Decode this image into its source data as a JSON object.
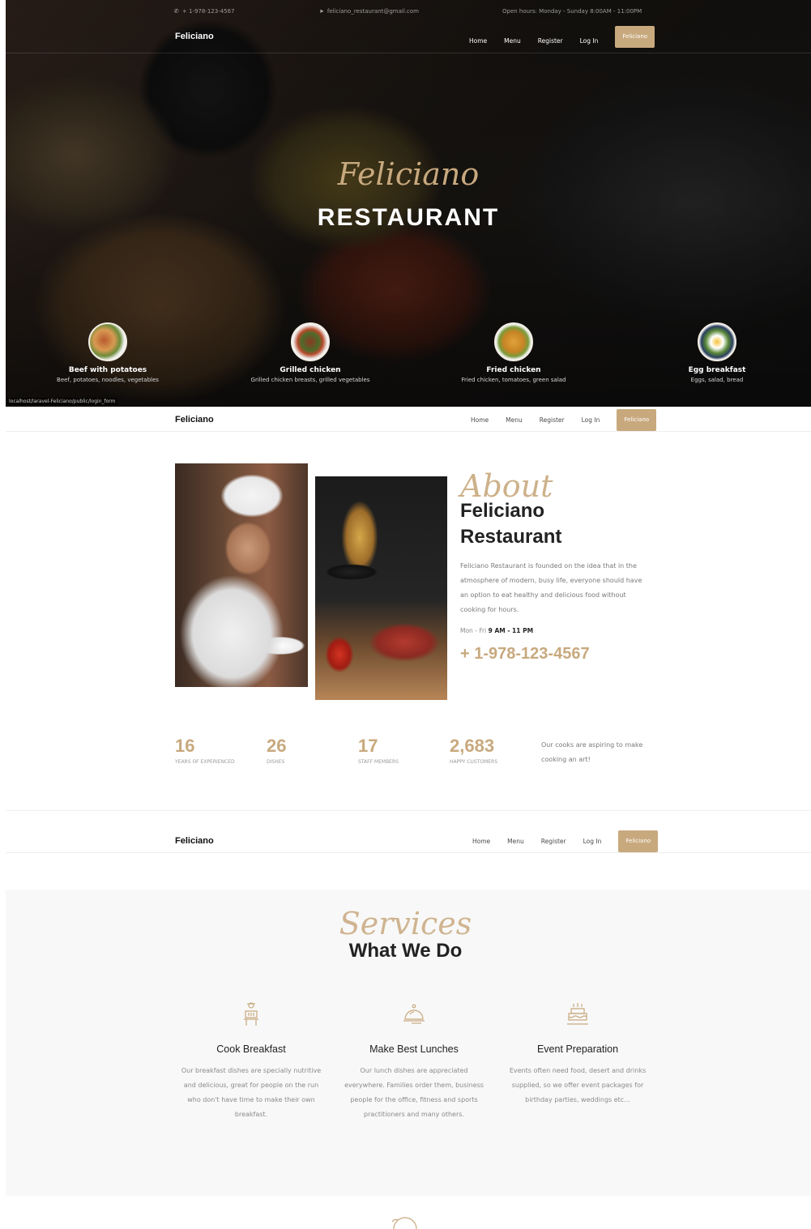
{
  "hero": {
    "topbar": {
      "phone": "+ 1-978-123-4567",
      "email": "feliciano_restaurant@gmail.com",
      "hours": "Open hours: Monday - Sunday 8:00AM - 11:00PM"
    },
    "title_script": "Feliciano",
    "title_main": "RESTAURANT",
    "status_url": "localhost/laravel-Feliciano/public/login_form",
    "dishes": [
      {
        "name": "Beef with potatoes",
        "desc": "Beef, potatoes, noodles, vegetables"
      },
      {
        "name": "Grilled chicken",
        "desc": "Grilled chicken breasts, grilled vegetables"
      },
      {
        "name": "Fried chicken",
        "desc": "Fried chicken, tomatoes, green salad"
      },
      {
        "name": "Egg breakfast",
        "desc": "Eggs, salad, bread"
      }
    ]
  },
  "nav": {
    "brand": "Feliciano",
    "items": [
      "Home",
      "Menu",
      "Register",
      "Log In"
    ],
    "button": "Feliciano"
  },
  "about": {
    "script": "About",
    "title_line1": "Feliciano",
    "title_line2": "Restaurant",
    "text": "Feliciano Restaurant is founded on the idea that in the atmosphere of modern, busy life, everyone should have an option to eat healthy and delicious food without cooking for hours.",
    "hours_prefix": "Mon - Fri",
    "hours_value": "9 AM - 11 PM",
    "phone": "+ 1-978-123-4567"
  },
  "stats": [
    {
      "num": "16",
      "label": "Years of Experienced"
    },
    {
      "num": "26",
      "label": "Dishes"
    },
    {
      "num": "17",
      "label": "Staff Members"
    },
    {
      "num": "2,683",
      "label": "Happy Customers"
    }
  ],
  "stats_note": "Our cooks are aspiring to make cooking an art!",
  "services": {
    "script": "Services",
    "title": "What We Do",
    "items": [
      {
        "name": "Cook Breakfast",
        "text": "Our breakfast dishes are specially nutritive and delicious, great for people on the run who don't have time to make their own breakfast.",
        "icon": "cook-icon"
      },
      {
        "name": "Make Best Lunches",
        "text": "Our lunch dishes are appreciated everywhere. Families order them, business people for the office, fitness and sports practitioners and many others.",
        "icon": "cloche-icon"
      },
      {
        "name": "Event Preparation",
        "text": "Events often need food, desert and drinks supplied, so we offer event packages for birthday parties, weddings etc...",
        "icon": "cake-icon"
      }
    ]
  },
  "colors": {
    "accent": "#c8a97e",
    "dark": "#222222",
    "muted": "#8a8a8a"
  }
}
